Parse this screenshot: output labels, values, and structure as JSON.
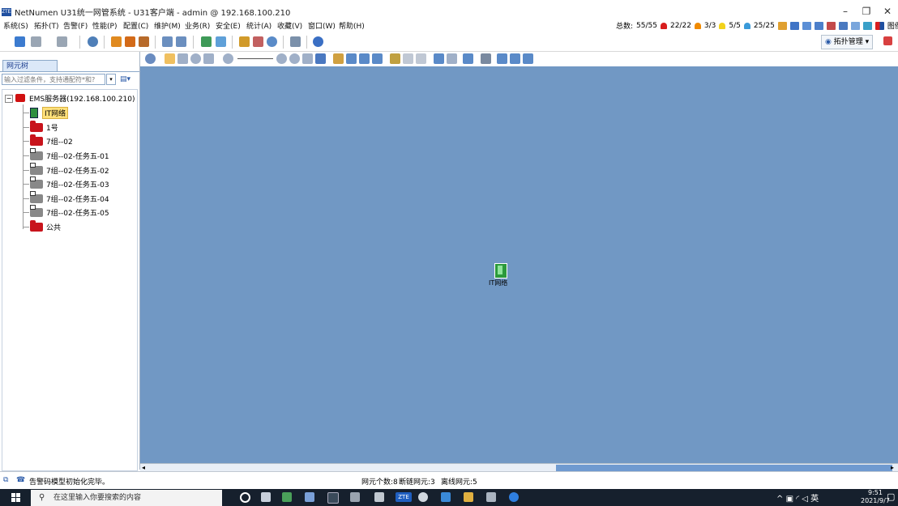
{
  "window": {
    "title": "NetNumen U31统一网管系统 - U31客户端 - admin @ 192.168.100.210",
    "logo": "ZTE",
    "minimize": "–",
    "restore": "❐",
    "close": "✕"
  },
  "menu": {
    "items": [
      "系统(S)",
      "拓扑(T)",
      "告警(F)",
      "性能(P)",
      "配置(C)",
      "维护(M)",
      "业务(R)",
      "安全(E)",
      "统计(A)",
      "收藏(V)",
      "窗口(W)",
      "帮助(H)"
    ]
  },
  "summary": {
    "total_label": "总数:",
    "total_value": "55/55",
    "critical_value": "22/22",
    "major_value": "3/3",
    "minor_value": "5/5",
    "warning_value": "25/25",
    "legend_label": "图例",
    "colors": {
      "critical": "#d81e1e",
      "major": "#f08a00",
      "minor": "#f2d21b",
      "warning": "#3a9ad9"
    }
  },
  "toolbar": {
    "topo_mgmt_label": "拓扑管理",
    "icon_names": [
      "refresh-icon",
      "back-icon",
      "forward-icon",
      "globe-icon",
      "alarm-icon",
      "alarm-stat-icon",
      "alarm-filter-icon",
      "window-icon",
      "view-icon",
      "chart-icon",
      "link-icon",
      "config-icon",
      "db-icon",
      "search-icon",
      "tools-icon",
      "help-icon"
    ]
  },
  "left_panel": {
    "tab_label": "网元树",
    "filter_placeholder": "输入过滤条件，支持通配符*和?",
    "tree": {
      "root_label": "EMS服务器(192.168.100.210)",
      "children": [
        {
          "label": "IT网络",
          "kind": "green",
          "selected": true
        },
        {
          "label": "1号",
          "kind": "folder"
        },
        {
          "label": "7组--02",
          "kind": "folder"
        },
        {
          "label": "7组--02-任务五-01",
          "kind": "gray"
        },
        {
          "label": "7组--02-任务五-02",
          "kind": "gray"
        },
        {
          "label": "7组--02-任务五-03",
          "kind": "gray"
        },
        {
          "label": "7组--02-任务五-04",
          "kind": "gray"
        },
        {
          "label": "7组--02-任务五-05",
          "kind": "gray"
        },
        {
          "label": "公共",
          "kind": "folder"
        }
      ]
    }
  },
  "canvas": {
    "background": "#7198c4",
    "node_label": "IT网络"
  },
  "statusbar": {
    "message": "告警码模型初始化完毕。",
    "ne_count": "网元个数:8",
    "disconnected": "断链网元:3",
    "offline": "离线网元:5"
  },
  "taskbar": {
    "search_placeholder": "在这里输入你要搜索的内容",
    "ime_label": "英",
    "time": "9:51",
    "date": "2021/9/7"
  }
}
